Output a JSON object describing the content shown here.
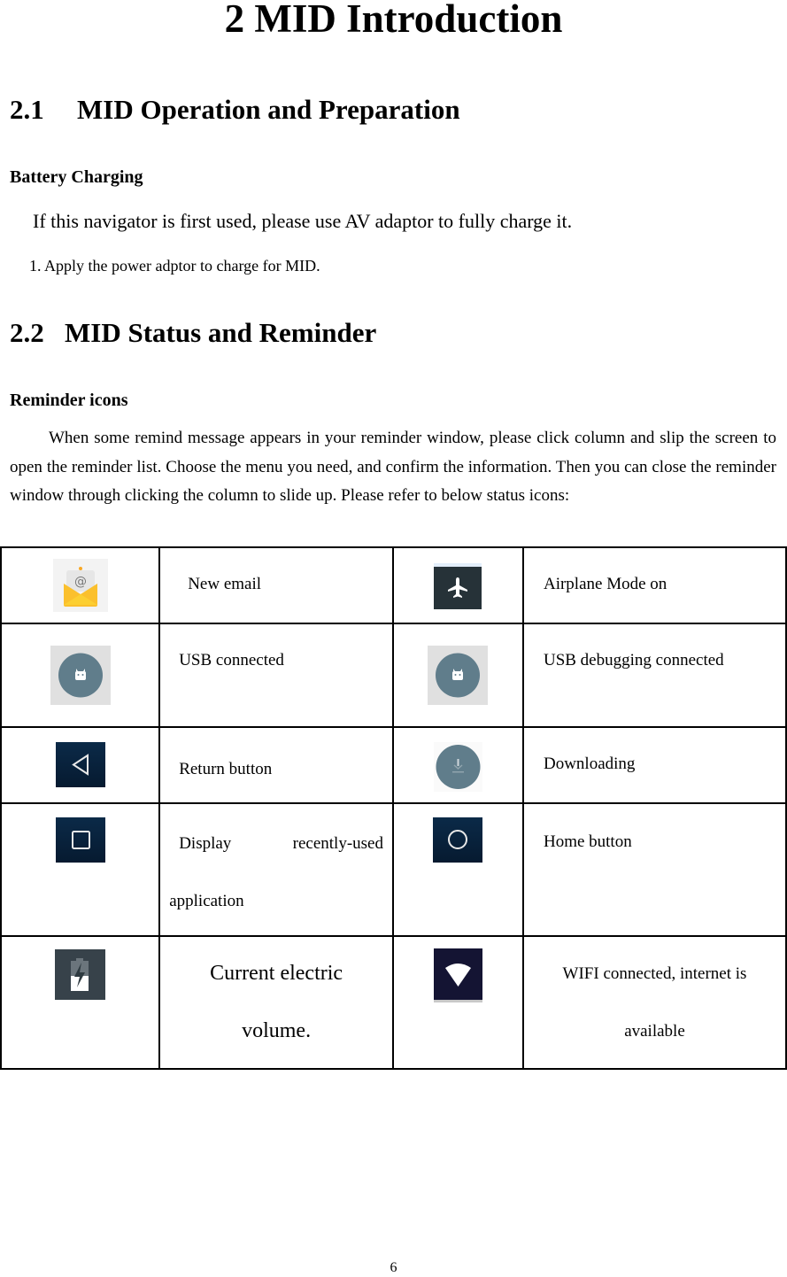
{
  "chapter_title": "2 MID Introduction",
  "section_1": {
    "number": "2.1",
    "title": "MID Operation and Preparation"
  },
  "battery": {
    "heading": "Battery Charging",
    "intro": "If this navigator is first used, please use AV adaptor to fully charge it.",
    "step_1": "1. Apply the power adptor to charge for MID."
  },
  "section_2": {
    "number": "2.2",
    "title": "MID Status and Reminder"
  },
  "reminder": {
    "heading": "Reminder icons",
    "paragraph": "When some remind message appears in your reminder window, please click column and slip the screen to open the reminder list. Choose the menu you need, and confirm the information. Then you can close the reminder window through clicking the column to slide up. Please refer to below status icons:"
  },
  "icon_table": {
    "rows": [
      {
        "left": {
          "icon": "new-email-icon",
          "label": "New email"
        },
        "right": {
          "icon": "airplane-mode-icon",
          "label": "Airplane Mode on"
        }
      },
      {
        "left": {
          "icon": "usb-android-icon",
          "label": "USB connected"
        },
        "right": {
          "icon": "usb-debugging-android-icon",
          "label": "USB debugging connected"
        }
      },
      {
        "left": {
          "icon": "back-triangle-icon",
          "label": "Return button"
        },
        "right": {
          "icon": "download-icon",
          "label": "Downloading"
        }
      },
      {
        "left": {
          "icon": "recent-apps-square-icon",
          "label_line1_a": "Display",
          "label_line1_b": "recently-used",
          "label_line2": "application"
        },
        "right": {
          "icon": "home-circle-icon",
          "label": "Home button"
        }
      },
      {
        "left": {
          "icon": "battery-charging-icon",
          "label_line1": "Current electric",
          "label_line2": "volume."
        },
        "right": {
          "icon": "wifi-icon",
          "label_line1": "WIFI connected, internet is",
          "label_line2": "available"
        }
      }
    ]
  },
  "colors": {
    "email_yellow": "#fbc02d",
    "android_circle": "#607d8b",
    "nav_dark_blue": "#0b2540",
    "airplane_bg": "#263238",
    "battery_bg": "#37424a",
    "wifi_bg": "#141433"
  },
  "page_number": "6"
}
